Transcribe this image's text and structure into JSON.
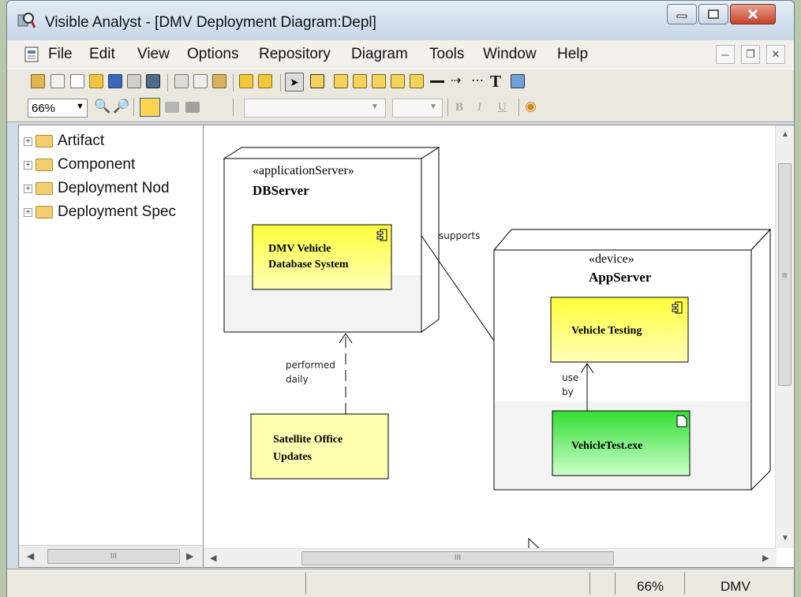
{
  "window": {
    "title": "Visible Analyst - [DMV Deployment Diagram:Depl]"
  },
  "menu": {
    "items": [
      "File",
      "Edit",
      "View",
      "Options",
      "Repository",
      "Diagram",
      "Tools",
      "Window",
      "Help"
    ]
  },
  "toolbar": {
    "zoom": "66%",
    "bold": "B",
    "italic": "I",
    "underline": "U"
  },
  "tree": {
    "items": [
      {
        "label": "Artifact"
      },
      {
        "label": "Component"
      },
      {
        "label": "Deployment Nod"
      },
      {
        "label": "Deployment Spec"
      }
    ],
    "hscroll_grip": "III"
  },
  "diagram": {
    "db_node": {
      "stereotype": "«applicationServer»",
      "name": "DBServer"
    },
    "db_component": {
      "line1": "DMV Vehicle",
      "line2": "Database System"
    },
    "app_node": {
      "stereotype": "«device»",
      "name": "AppServer"
    },
    "app_component": {
      "name": "Vehicle Testing"
    },
    "artifact": {
      "name": "VehicleTest.exe"
    },
    "satellite": {
      "line1": "Satellite Office",
      "line2": "Updates"
    },
    "link_supports": "supports",
    "link_performed": {
      "line1": "performed",
      "line2": "daily"
    },
    "link_use": {
      "line1": "use",
      "line2": "by"
    },
    "hscroll_grip": "III",
    "vscroll_grip": "≡"
  },
  "status": {
    "zoom": "66%",
    "project": "DMV"
  },
  "colors": {
    "component_yellow": "#ffff3a",
    "artifact_green": "#33dd33",
    "note_yellow": "#ffffb0"
  }
}
